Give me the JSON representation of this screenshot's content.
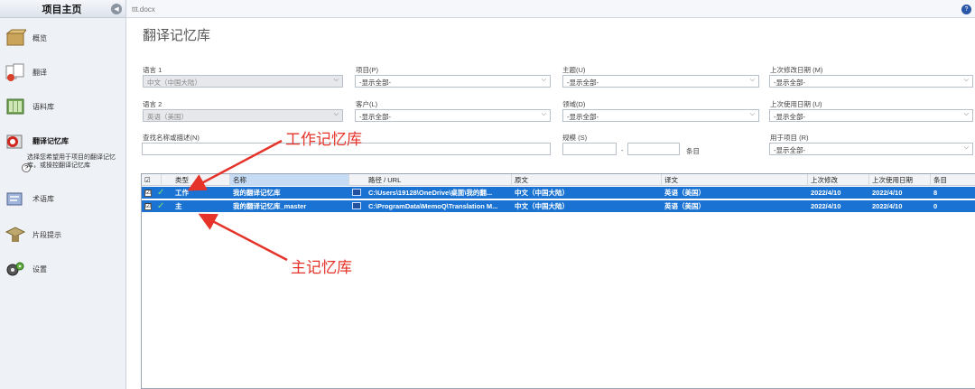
{
  "sidebar": {
    "title": "项目主页",
    "items": [
      {
        "label": "概览",
        "icon": "box-icon"
      },
      {
        "label": "翻译",
        "icon": "papers-icon"
      },
      {
        "label": "语料库",
        "icon": "books-icon"
      },
      {
        "label": "翻译记忆库",
        "icon": "tm-icon",
        "active": true
      },
      {
        "label": "术语库",
        "icon": "termbase-icon"
      },
      {
        "label": "片段提示",
        "icon": "muses-icon"
      },
      {
        "label": "设置",
        "icon": "gears-icon"
      }
    ],
    "description": "选择您希望用于项目的翻译记忆库，或操控翻译记忆库",
    "help_glyph": "?"
  },
  "tabbar": {
    "doc_tab": "ttt.docx",
    "help_glyph": "?"
  },
  "page_title": "翻译记忆库",
  "filters": {
    "lang1_label": "语言 1",
    "lang1_value": "中文（中国大陆）",
    "lang2_label": "语言 2",
    "lang2_value": "英语（美国）",
    "project_label": "项目(P)",
    "project_value": "-显示全部-",
    "client_label": "客户(L)",
    "client_value": "-显示全部-",
    "subject_label": "主题(U)",
    "subject_value": "-显示全部-",
    "domain_label": "领域(D)",
    "domain_value": "-显示全部-",
    "modified_label": "上次修改日期 (M)",
    "modified_value": "-显示全部-",
    "used_label": "上次使用日期 (U)",
    "used_value": "-显示全部-",
    "search_label": "查找名称或描述(N)",
    "size_label": "规模 (S)",
    "size_dash": "-",
    "size_unit": "条目",
    "used_in_label": "用于项目 (R)",
    "used_in_value": "-显示全部-"
  },
  "grid": {
    "headers": {
      "check": "☑",
      "type": "类型",
      "name": "名称",
      "path": "路径 / URL",
      "source": "原文",
      "target": "译文",
      "modified": "上次修改",
      "used": "上次使用日期",
      "entries": "条目"
    },
    "rows": [
      {
        "check": "☑",
        "tick": "✓",
        "type": "工作",
        "name": "我的翻译记忆库",
        "path": "C:\\Users\\19128\\OneDrive\\桌面\\我的翻...",
        "source": "中文（中国大陆）",
        "target": "英语（美国）",
        "modified": "2022/4/10",
        "used": "2022/4/10",
        "entries": "8"
      },
      {
        "check": "☑",
        "tick": "✓",
        "type": "主",
        "name": "我的翻译记忆库_master",
        "path": "C:\\ProgramData\\MemoQ\\Translation M...",
        "source": "中文（中国大陆）",
        "target": "英语（美国）",
        "modified": "2022/4/10",
        "used": "2022/4/10",
        "entries": "0"
      }
    ]
  },
  "annotations": {
    "working": "工作记忆库",
    "master": "主记忆库",
    "color": "#e5332a"
  }
}
